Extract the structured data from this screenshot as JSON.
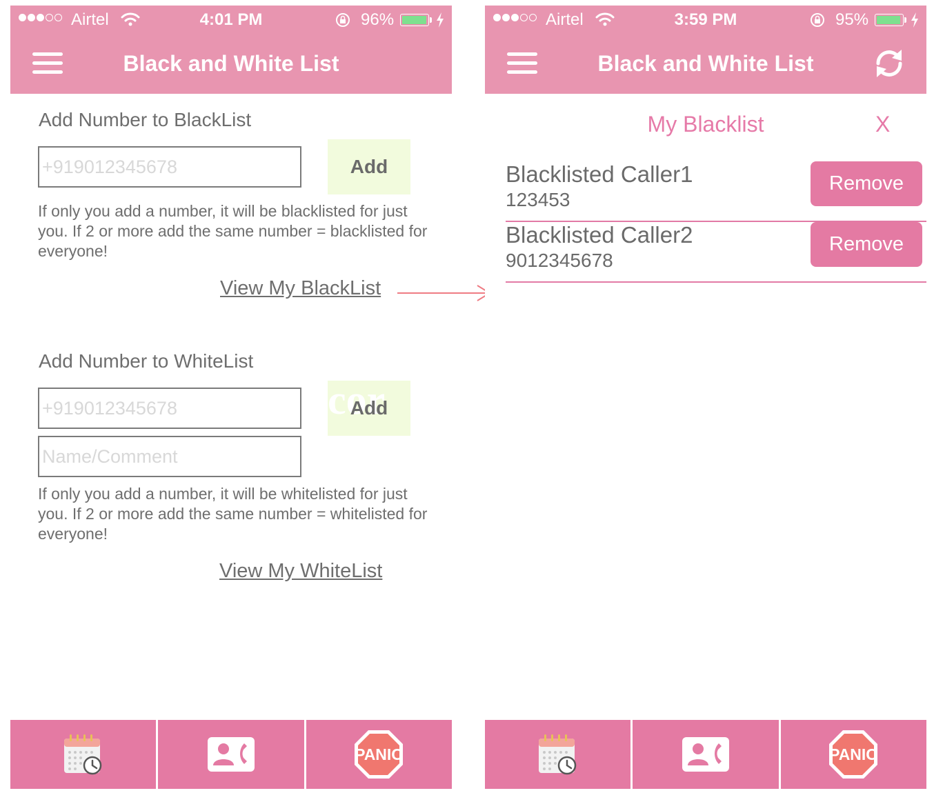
{
  "left": {
    "status": {
      "carrier": "Airtel",
      "time": "4:01 PM",
      "battery_pct": "96%",
      "battery_level": 0.96
    },
    "header": {
      "title": "Black and White List"
    },
    "blacklist": {
      "heading": "Add Number to BlackList",
      "number_placeholder": "+919012345678",
      "add_label": "Add",
      "help": "If only you add a number, it will be blacklisted for just you. If 2 or more add the same number = blacklisted for everyone!",
      "view_link": "View My BlackList"
    },
    "whitelist": {
      "heading": "Add Number to WhiteList",
      "number_placeholder": "+919012345678",
      "comment_placeholder": "Name/Comment",
      "add_label": "Add",
      "add_ghost": "cor",
      "help": "If only you add a number, it will be whitelisted for just you. If 2 or more add the same number = whitelisted for everyone!",
      "view_link": "View My WhiteList"
    },
    "tabs": [
      {
        "icon": "calendar-clock-icon"
      },
      {
        "icon": "contact-call-icon"
      },
      {
        "icon": "panic-stop-icon",
        "label": "PANIC"
      }
    ]
  },
  "right": {
    "status": {
      "carrier": "Airtel",
      "time": "3:59 PM",
      "battery_pct": "95%",
      "battery_level": 0.95
    },
    "header": {
      "title": "Black and White List",
      "refresh_icon": "refresh-icon"
    },
    "list": {
      "title": "My Blacklist",
      "close_label": "X",
      "items": [
        {
          "name": "Blacklisted Caller1",
          "number": "123453",
          "action": "Remove"
        },
        {
          "name": "Blacklisted Caller2",
          "number": "9012345678",
          "action": "Remove"
        }
      ]
    },
    "tabs": [
      {
        "icon": "calendar-clock-icon"
      },
      {
        "icon": "contact-call-icon"
      },
      {
        "icon": "panic-stop-icon",
        "label": "PANIC"
      }
    ]
  },
  "colors": {
    "header": "#e895b0",
    "tabbar": "#e47aa3",
    "accent": "#e67aa8",
    "add_button": "#f2fbdd",
    "battery": "#7ee08f",
    "arrow": "#ef7b83"
  }
}
